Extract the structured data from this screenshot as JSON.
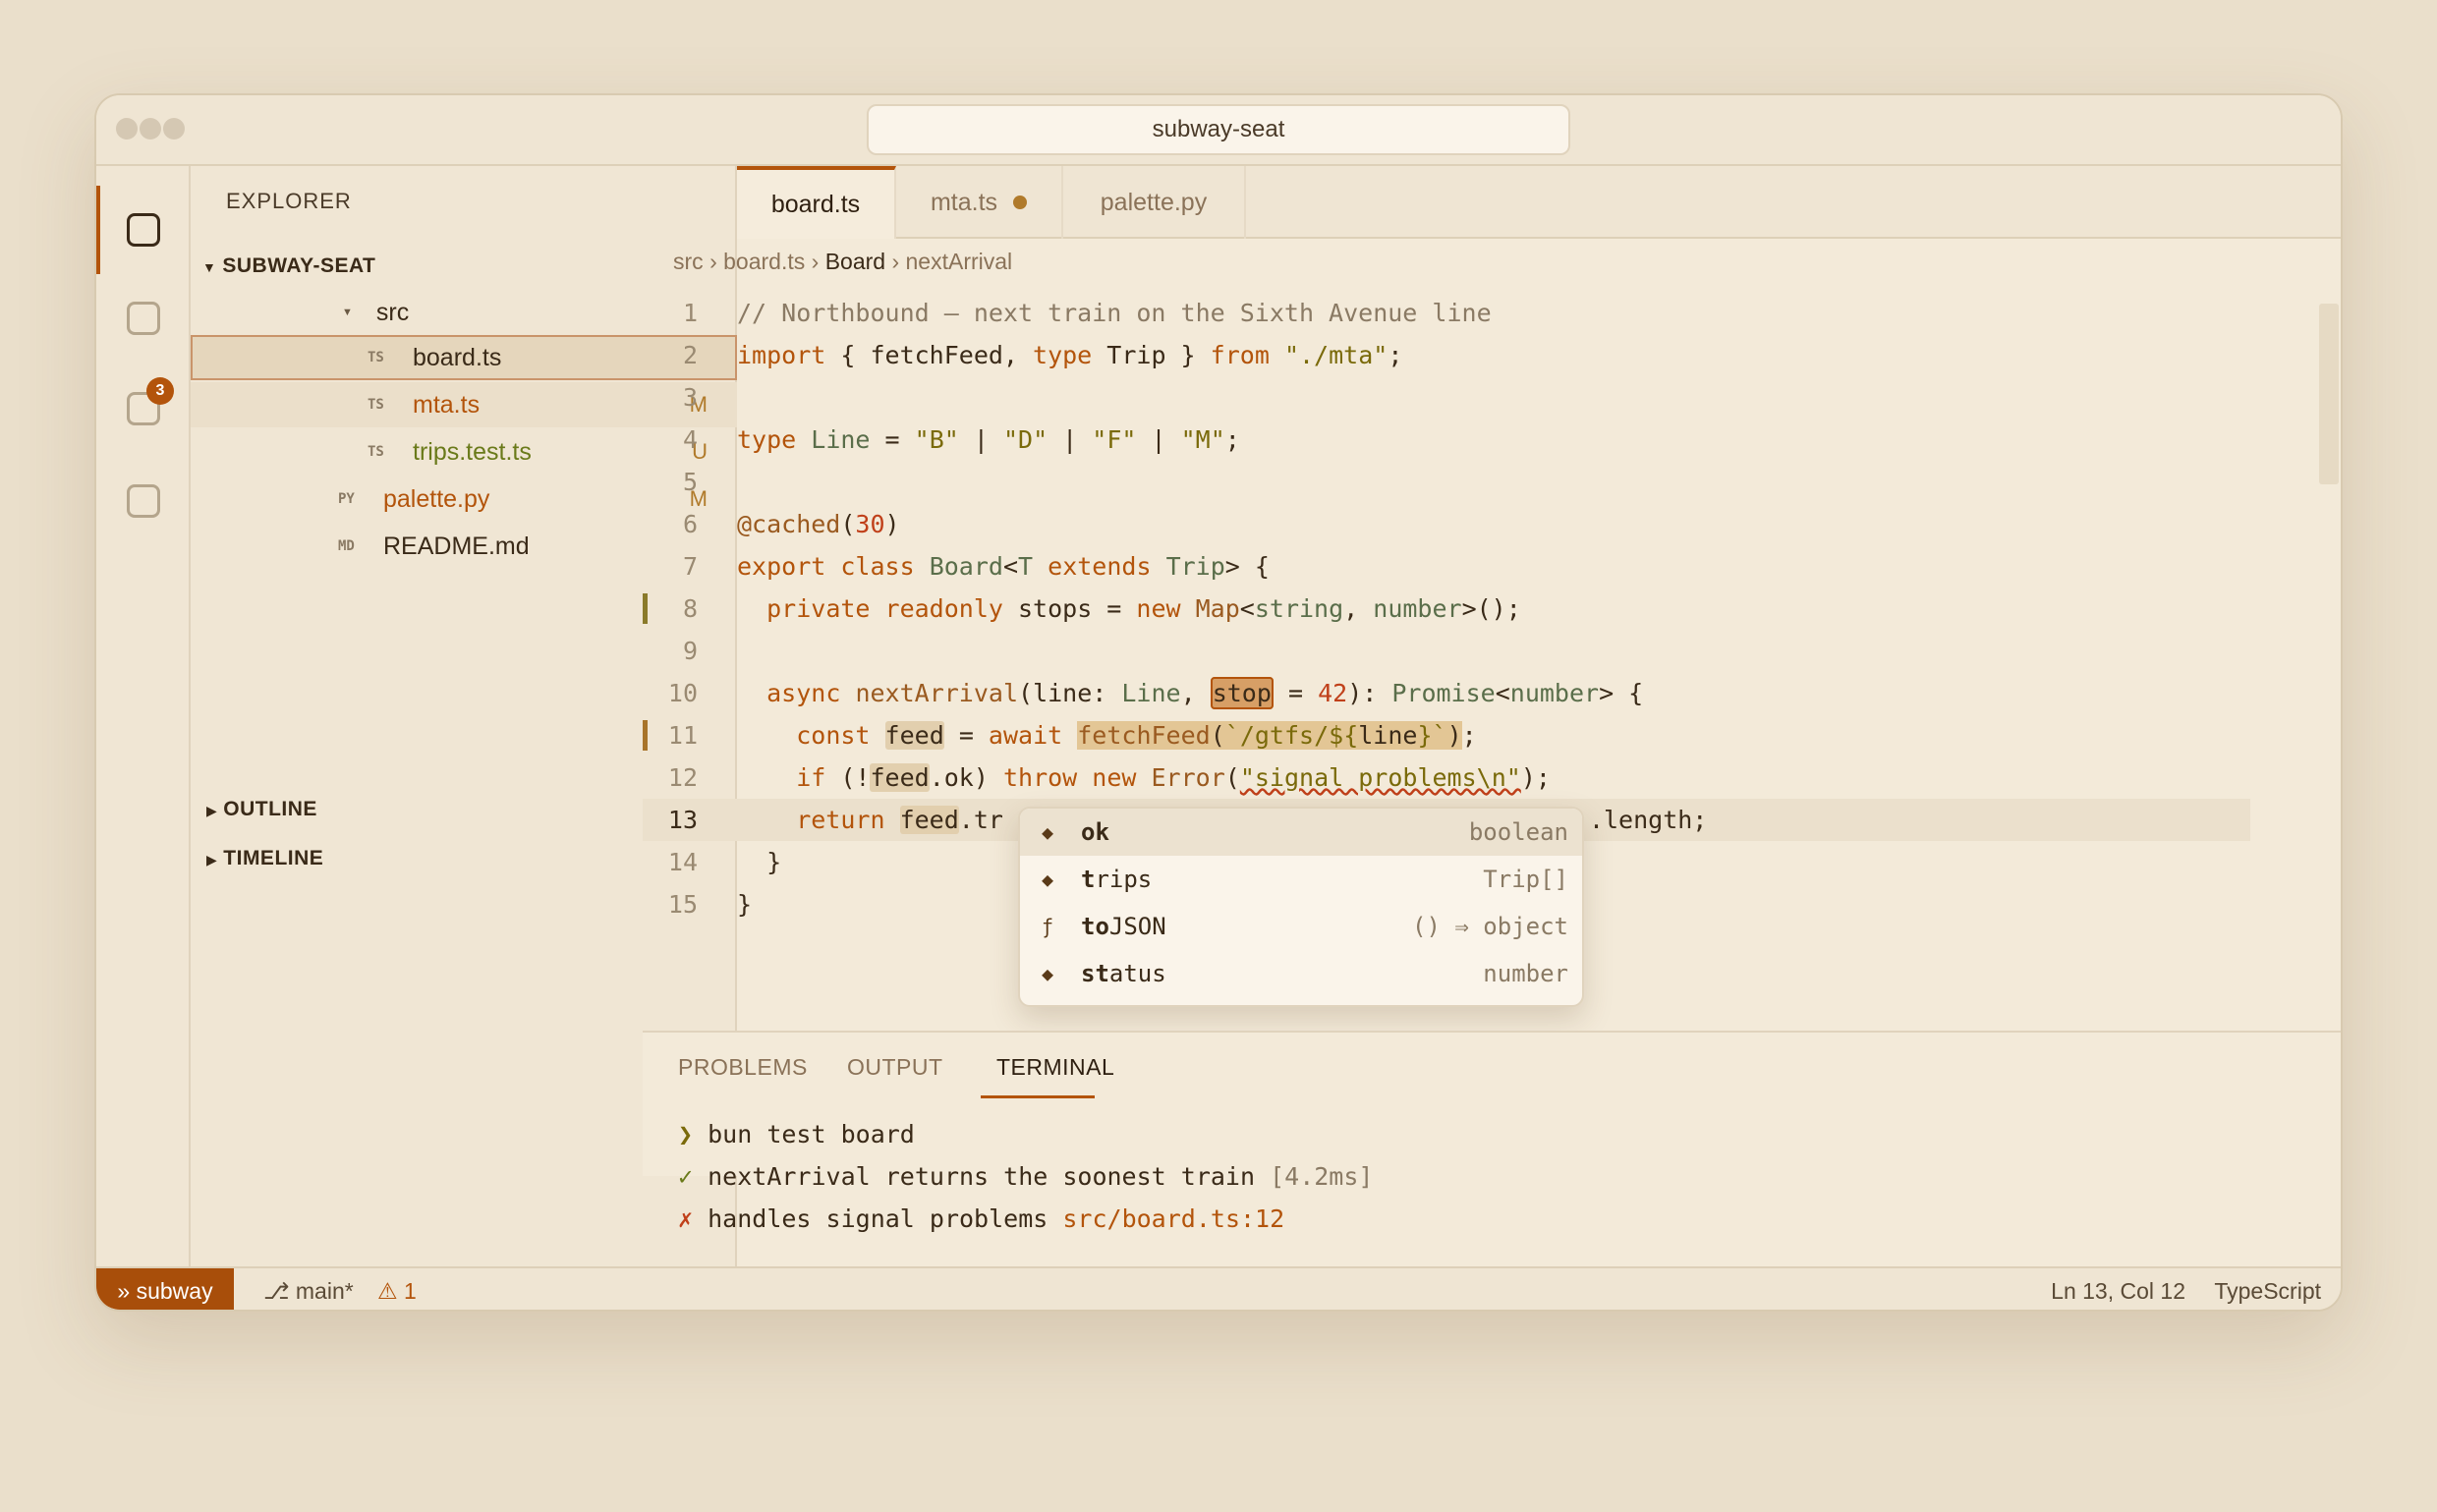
{
  "window": {
    "title": "subway-seat"
  },
  "activity": {
    "badge": "3"
  },
  "sidebar": {
    "title": "EXPLORER",
    "root": "SUBWAY-SEAT",
    "folder": "src",
    "files": [
      {
        "icon": "TS",
        "name": "board.ts",
        "status": ""
      },
      {
        "icon": "TS",
        "name": "mta.ts",
        "status": "M"
      },
      {
        "icon": "TS",
        "name": "trips.test.ts",
        "status": "U"
      },
      {
        "icon": "PY",
        "name": "palette.py",
        "status": "M"
      },
      {
        "icon": "MD",
        "name": "README.md",
        "status": ""
      }
    ],
    "outline": "OUTLINE",
    "timeline": "TIMELINE"
  },
  "tabs": [
    "board.ts",
    "mta.ts",
    "palette.py"
  ],
  "breadcrumb": {
    "p1": "src",
    "p2": "board.ts",
    "p3": "Board",
    "p4": "nextArrival",
    "sep": "›"
  },
  "editor": {
    "line_numbers": [
      "1",
      "2",
      "3",
      "4",
      "5",
      "6",
      "7",
      "8",
      "9",
      "10",
      "11",
      "12",
      "13",
      "14",
      "15"
    ],
    "l1": "// Northbound — next train on the Sixth Avenue line",
    "l13_pre": "    return ",
    "l13_feed": "feed",
    "l13_mid": ".tr",
    "l13_post": ".length;"
  },
  "suggestions": [
    {
      "icon": "◆",
      "match": "ok",
      "rest": "",
      "detail": "boolean"
    },
    {
      "icon": "◆",
      "match": "t",
      "rest": "rips",
      "detail": "Trip[]"
    },
    {
      "icon": "ƒ",
      "match": "to",
      "rest": "JSON",
      "detail": "() ⇒ object"
    },
    {
      "icon": "◆",
      "match": "st",
      "rest": "atus",
      "detail": "number"
    }
  ],
  "panel": {
    "tabs": [
      "PROBLEMS",
      "OUTPUT",
      "TERMINAL"
    ],
    "active_tab": "TERMINAL",
    "terminal": [
      {
        "mark": "❯",
        "text": "bun test board",
        "extra": ""
      },
      {
        "mark": "✓",
        "text": "nextArrival returns the soonest train",
        "extra": "[4.2ms]"
      },
      {
        "mark": "✗",
        "text": "handles signal problems",
        "extra": "src/board.ts:12"
      }
    ]
  },
  "statusbar": {
    "remote": "» subway",
    "branch": "⎇ main*",
    "warnings": "⚠ 1",
    "position": "Ln 13, Col 12",
    "language": "TypeScript"
  },
  "colors": {
    "accent": "#b3540b",
    "background": "#eadfcb",
    "editor": "#f3ead9"
  }
}
